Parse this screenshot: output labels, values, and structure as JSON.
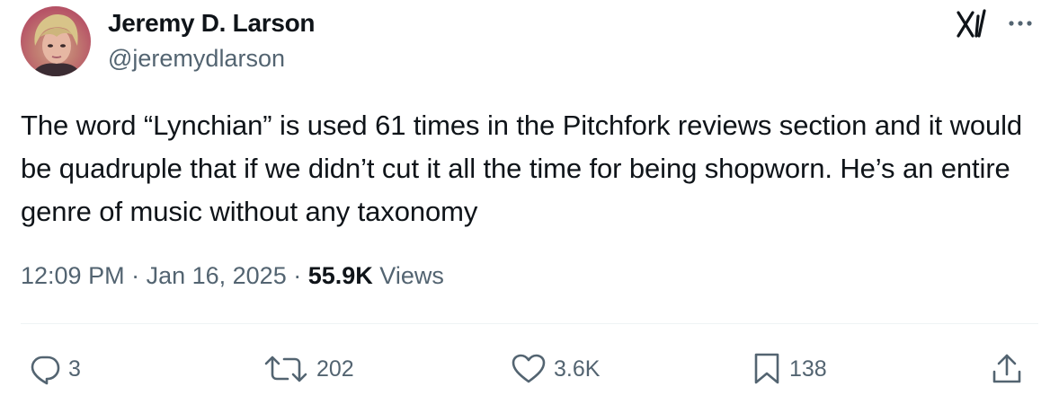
{
  "author": {
    "name": "Jeremy D. Larson",
    "handle": "@jeremydlarson"
  },
  "tweet": {
    "text": "The word “Lynchian” is used 61 times in the Pitchfork reviews section and it would be quadruple that if we didn’t cut it all the time for being shopworn. He’s an entire genre of music without any taxonomy"
  },
  "meta": {
    "time": "12:09 PM",
    "separator": " · ",
    "date": "Jan 16, 2025",
    "views_count": "55.9K",
    "views_label": "Views"
  },
  "actions": {
    "replies": "3",
    "reposts": "202",
    "likes": "3.6K",
    "bookmarks": "138"
  },
  "icons": {
    "top_right": [
      "grok-icon",
      "more-icon"
    ],
    "actions": [
      "reply-icon",
      "retweet-icon",
      "like-icon",
      "bookmark-icon",
      "share-icon"
    ]
  },
  "colors": {
    "text_primary": "#0f1419",
    "text_secondary": "#536471",
    "divider": "#eff3f4"
  }
}
